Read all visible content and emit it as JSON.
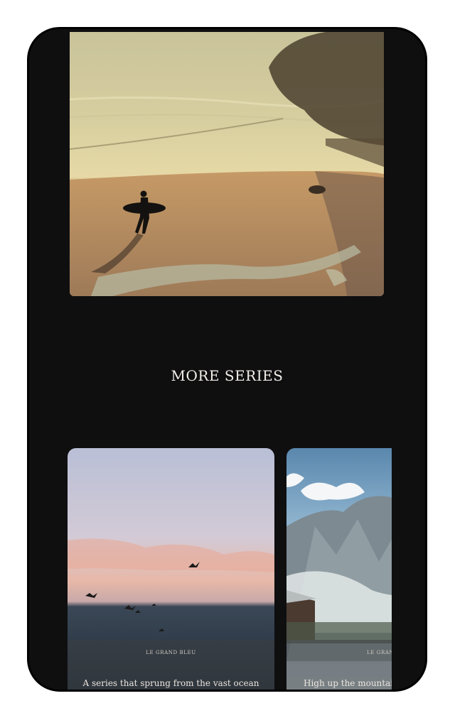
{
  "sections": {
    "more_series_title": "MORE SERIES"
  },
  "series_cards": [
    {
      "name": "LE GRAND BLEU",
      "description": "A series that sprung from the vast ocean"
    },
    {
      "name": "LE GRAN",
      "description": "High up the mountai"
    }
  ],
  "colors": {
    "background": "#0f0f10",
    "title_text": "#f2efe9"
  }
}
